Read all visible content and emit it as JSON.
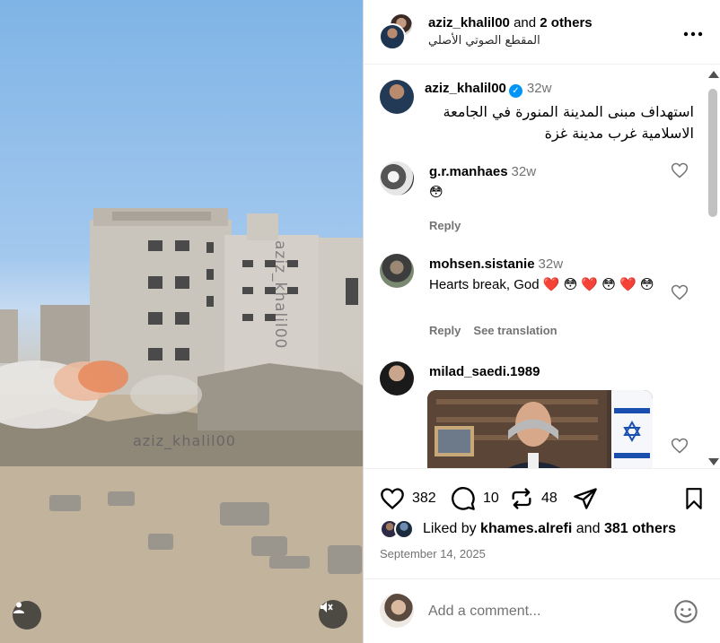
{
  "header": {
    "username": "aziz_khalil00",
    "and_others": "and",
    "others_count": "2 others",
    "audio": "المقطع الصوتي الأصلي",
    "more": "..."
  },
  "media": {
    "watermark": "aziz_khalil00",
    "watermark2": "aziz_khalil00"
  },
  "caption": {
    "username": "aziz_khalil00",
    "time": "32w",
    "text": "استهداف مبنى المدينة المنورة في الجامعة الاسلامية غرب مدينة غزة"
  },
  "comments": [
    {
      "username": "g.r.manhaes",
      "time": "32w",
      "text": "😳",
      "reply": "Reply"
    },
    {
      "username": "mohsen.sistanie",
      "time": "32w",
      "text": "Hearts break, God ❤️ 😳 ❤️ 😳 ❤️ 😳",
      "reply": "Reply",
      "translate": "See translation"
    },
    {
      "username": "milad_saedi.1989"
    }
  ],
  "actions": {
    "likes": "382",
    "comments": "10",
    "reposts": "48"
  },
  "liked_by": {
    "prefix": "Liked by",
    "user": "khames.alrefi",
    "and": "and",
    "others": "381 others"
  },
  "date": "September 14, 2025",
  "add_comment": {
    "placeholder": "Add a comment..."
  },
  "colors": {
    "verified": "#0095f6",
    "secondary_text": "#737373",
    "border": "#dbdbdb"
  }
}
